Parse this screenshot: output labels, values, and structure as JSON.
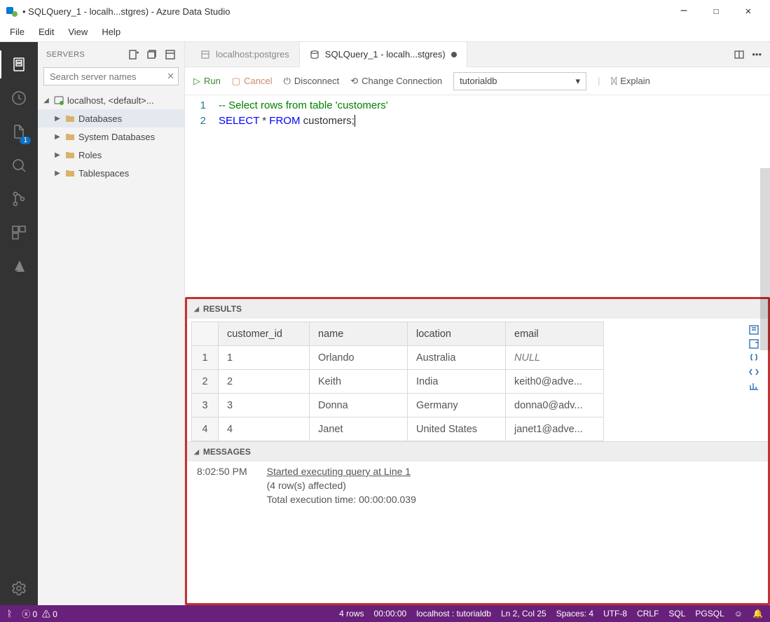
{
  "window": {
    "title": "• SQLQuery_1 - localh...stgres) - Azure Data Studio"
  },
  "menus": [
    "File",
    "Edit",
    "View",
    "Help"
  ],
  "activity": {
    "explorer_badge": "1"
  },
  "sidebar": {
    "title": "SERVERS",
    "search_placeholder": "Search server names",
    "connection_label": "localhost, <default>...",
    "items": [
      {
        "label": "Databases"
      },
      {
        "label": "System Databases"
      },
      {
        "label": "Roles"
      },
      {
        "label": "Tablespaces"
      }
    ]
  },
  "tabs": [
    {
      "label": "localhost:postgres",
      "active": false
    },
    {
      "label": "SQLQuery_1 - localh...stgres)",
      "active": true,
      "dirty": true
    }
  ],
  "toolbar": {
    "run": "Run",
    "cancel": "Cancel",
    "disconnect": "Disconnect",
    "change_conn": "Change Connection",
    "database": "tutorialdb",
    "explain": "Explain"
  },
  "editor": {
    "lines": [
      {
        "n": "1",
        "comment": "-- Select rows from table 'customers'"
      },
      {
        "n": "2",
        "kw1": "SELECT",
        "mid": " * ",
        "kw2": "FROM",
        "tail": " customers;"
      }
    ]
  },
  "results": {
    "title": "RESULTS",
    "columns": [
      "customer_id",
      "name",
      "location",
      "email"
    ],
    "rows": [
      {
        "n": "1",
        "cells": [
          "1",
          "Orlando",
          "Australia",
          "NULL"
        ],
        "null_col": 3
      },
      {
        "n": "2",
        "cells": [
          "2",
          "Keith",
          "India",
          "keith0@adve..."
        ]
      },
      {
        "n": "3",
        "cells": [
          "3",
          "Donna",
          "Germany",
          "donna0@adv..."
        ]
      },
      {
        "n": "4",
        "cells": [
          "4",
          "Janet",
          "United States",
          "janet1@adve..."
        ]
      }
    ]
  },
  "messages": {
    "title": "MESSAGES",
    "time": "8:02:50 PM",
    "line1": "Started executing query at Line 1",
    "line2": "(4 row(s) affected)",
    "line3": "Total execution time: 00:00:00.039"
  },
  "status": {
    "errors": "0",
    "warnings": "0",
    "rows": "4 rows",
    "elapsed": "00:00:00",
    "server": "localhost : tutorialdb",
    "pos": "Ln 2, Col 25",
    "spaces": "Spaces: 4",
    "encoding": "UTF-8",
    "eol": "CRLF",
    "lang": "SQL",
    "mode": "PGSQL"
  }
}
